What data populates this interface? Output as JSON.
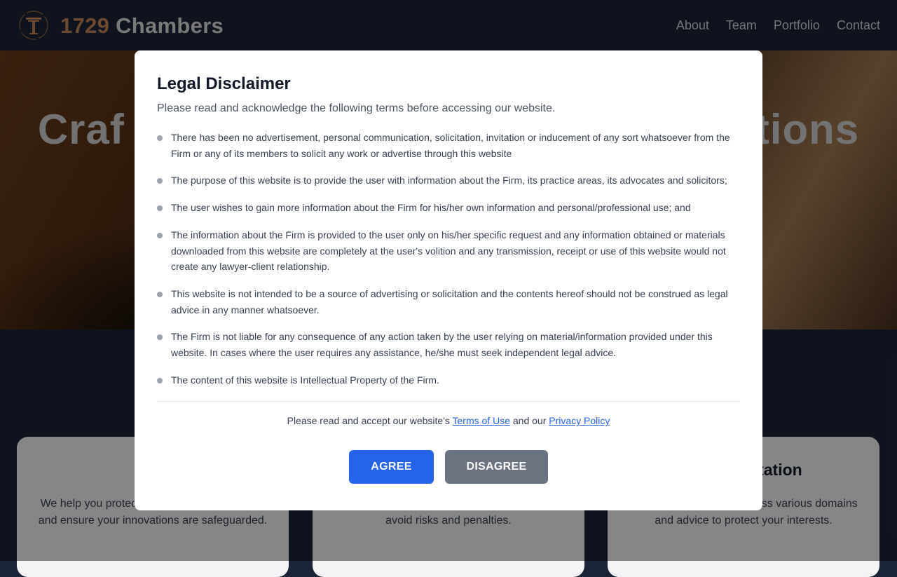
{
  "header": {
    "brand_number": "1729",
    "brand_name": "Chambers",
    "logo_icon": "pillar-logo-icon",
    "nav": [
      "About",
      "Team",
      "Portfolio",
      "Contact"
    ]
  },
  "hero": {
    "title_left": "Craf",
    "title_right": "tions"
  },
  "cards": [
    {
      "title": "",
      "text": "We help you protect your intellectual property and ensure your innovations are safeguarded."
    },
    {
      "title": "",
      "text": "Navigate complex regulatory requirements to avoid risks and penalties."
    },
    {
      "title": "Representation",
      "text": "Expert representation across various domains and advice to protect your interests."
    }
  ],
  "modal": {
    "title": "Legal Disclaimer",
    "subtitle": "Please read and acknowledge the following terms before accessing our website.",
    "terms": [
      "There has been no advertisement, personal communication, solicitation, invitation or inducement of any sort whatsoever from the Firm or any of its members to solicit any work or advertise through this website",
      "The purpose of this website is to provide the user with information about the Firm, its practice areas, its advocates and solicitors;",
      "The user wishes to gain more information about the Firm for his/her own information and personal/professional use; and",
      "The information about the Firm is provided to the user only on his/her specific request and any information obtained or materials downloaded from this website are completely at the user's volition and any transmission, receipt or use of this website would not create any lawyer-client relationship.",
      "This website is not intended to be a source of advertising or solicitation and the contents hereof should not be construed as legal advice in any manner whatsoever.",
      "The Firm is not liable for any consequence of any action taken by the user relying on material/information provided under this website. In cases where the user requires any assistance, he/she must seek independent legal advice.",
      "The content of this website is Intellectual Property of the Firm."
    ],
    "accept_prefix": "Please read and accept our website's ",
    "terms_link": "Terms of Use",
    "accept_middle": " and our ",
    "privacy_link": "Privacy Policy",
    "agree": "AGREE",
    "disagree": "DISAGREE"
  },
  "colors": {
    "primary": "#2563eb",
    "secondary_button": "#6b7280",
    "brand_accent": "#c5875a",
    "header_bg": "#1b2436"
  }
}
